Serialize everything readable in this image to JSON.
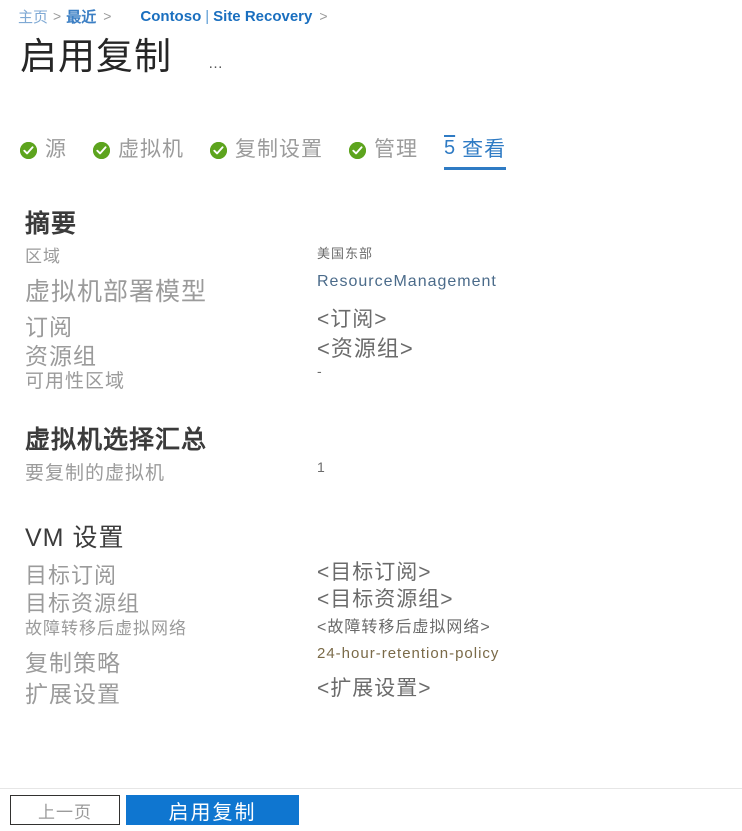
{
  "breadcrumb": {
    "items": [
      {
        "label": "主页",
        "style": "muted"
      },
      {
        "label": "最近",
        "style": "strong"
      },
      {
        "label": "Contoso",
        "style": "dark"
      },
      {
        "label": "Site Recovery",
        "style": "dark"
      }
    ],
    "separator": ">",
    "pipe": "|"
  },
  "header": {
    "title": "启用复制",
    "more_menu": "…"
  },
  "tabs": [
    {
      "label": "源",
      "state": "complete",
      "icon": "check-circle-icon"
    },
    {
      "label": "虚拟机",
      "state": "complete",
      "icon": "check-circle-icon"
    },
    {
      "label": "复制设置",
      "state": "complete",
      "icon": "check-circle-icon"
    },
    {
      "label": "管理",
      "state": "complete",
      "icon": "check-circle-icon"
    },
    {
      "label": "查看",
      "state": "active",
      "step": "5"
    }
  ],
  "sections": [
    {
      "heading": "摘要",
      "rows": [
        {
          "label": "区域",
          "value": "美国东部"
        },
        {
          "label": "虚拟机部署模型",
          "value": "ResourceManagement"
        },
        {
          "label": "订阅",
          "value": "<订阅>"
        },
        {
          "label": "资源组",
          "value": "<资源组>"
        },
        {
          "label": "可用性区域",
          "value": "-"
        }
      ]
    },
    {
      "heading": "虚拟机选择汇总",
      "rows": [
        {
          "label": "要复制的虚拟机",
          "value": "1"
        }
      ]
    },
    {
      "heading": "VM 设置",
      "rows": [
        {
          "label": "目标订阅",
          "value": "<目标订阅>"
        },
        {
          "label": "目标资源组",
          "value": "<目标资源组>"
        },
        {
          "label": "故障转移后虚拟网络",
          "value": "<故障转移后虚拟网络>"
        },
        {
          "label": "复制策略",
          "value": "24-hour-retention-policy"
        },
        {
          "label": "扩展设置",
          "value": "<扩展设置>"
        }
      ]
    }
  ],
  "footer": {
    "previous_label": "上一页",
    "submit_label": "启用复制"
  },
  "colors": {
    "accent": "#0f76d0",
    "link": "#5b9bd5",
    "success": "#5da41e",
    "label": "#9b9b9b",
    "value": "#6b6b6b"
  }
}
